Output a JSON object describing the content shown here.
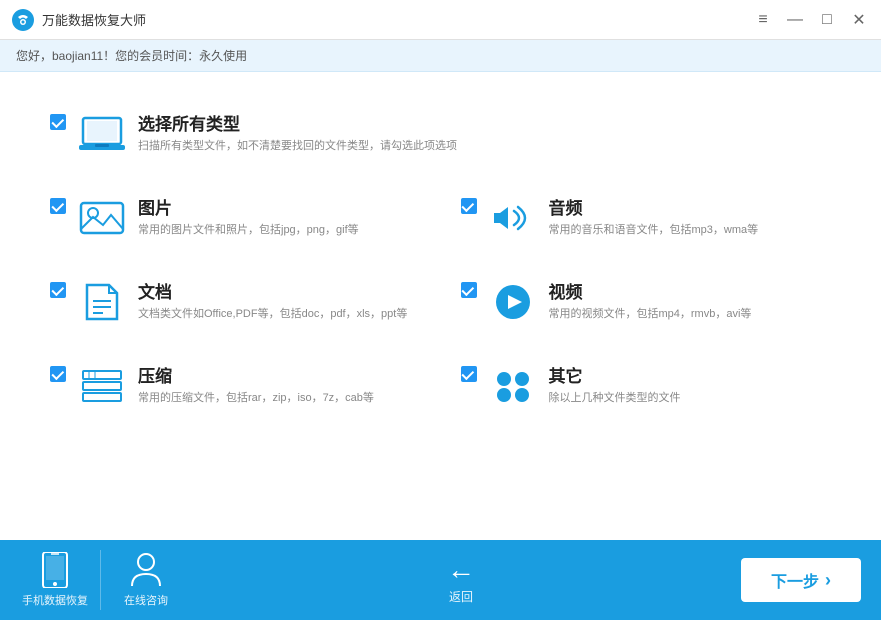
{
  "titleBar": {
    "appName": "万能数据恢复大师",
    "controls": {
      "minimize": "—",
      "restore": "□",
      "close": "✕"
    }
  },
  "infoBar": {
    "text": "您好，baojian11！您的会员时间：永久使用"
  },
  "categories": [
    {
      "id": "all",
      "name": "选择所有类型",
      "desc": "扫描所有类型文件，如不清楚要找回的文件类型，请勾选此项选项",
      "checked": true,
      "fullWidth": true,
      "iconType": "laptop"
    },
    {
      "id": "image",
      "name": "图片",
      "desc": "常用的图片文件和照片，包括jpg，png，gif等",
      "checked": true,
      "fullWidth": false,
      "iconType": "image"
    },
    {
      "id": "audio",
      "name": "音频",
      "desc": "常用的音乐和语音文件，包括mp3，wma等",
      "checked": true,
      "fullWidth": false,
      "iconType": "audio"
    },
    {
      "id": "document",
      "name": "文档",
      "desc": "文档类文件如Office,PDF等，包括doc，pdf，xls，ppt等",
      "checked": true,
      "fullWidth": false,
      "iconType": "document"
    },
    {
      "id": "video",
      "name": "视频",
      "desc": "常用的视频文件，包括mp4，rmvb，avi等",
      "checked": true,
      "fullWidth": false,
      "iconType": "video"
    },
    {
      "id": "compress",
      "name": "压缩",
      "desc": "常用的压缩文件，包括rar，zip，iso，7z，cab等",
      "checked": true,
      "fullWidth": false,
      "iconType": "compress"
    },
    {
      "id": "other",
      "name": "其它",
      "desc": "除以上几种文件类型的文件",
      "checked": true,
      "fullWidth": false,
      "iconType": "other"
    }
  ],
  "bottomBar": {
    "phoneRecovery": "手机数据恢复",
    "onlineConsult": "在线咨询",
    "back": "返回",
    "nextStep": "下一步",
    "nextArrow": "›"
  },
  "colors": {
    "primary": "#1a9de0",
    "checkboxBlue": "#2196f3"
  }
}
